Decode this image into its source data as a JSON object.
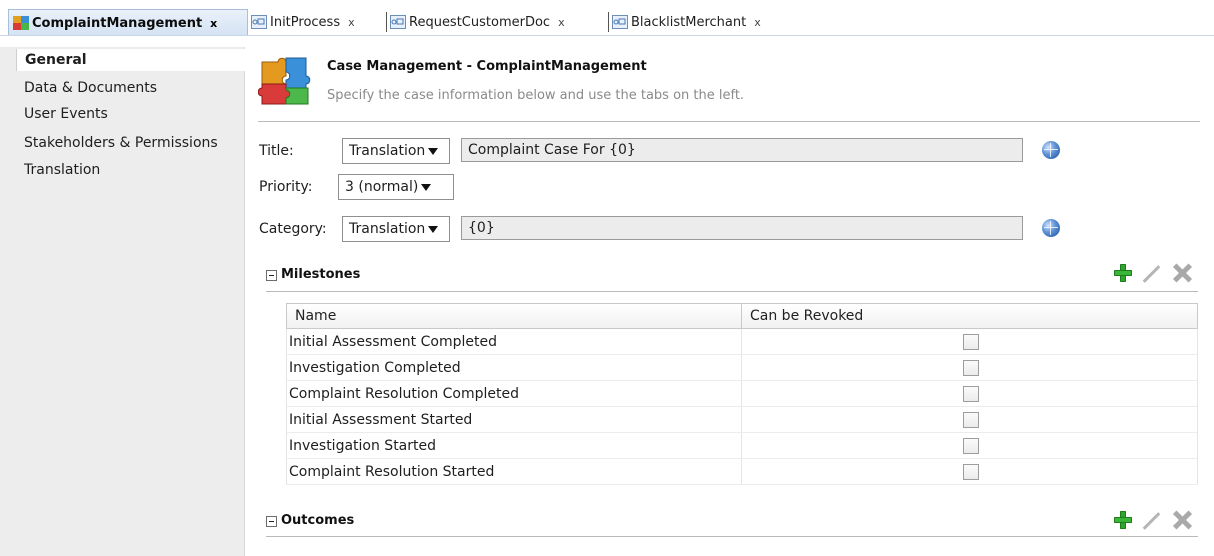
{
  "tabs": [
    {
      "label": "ComplaintManagement",
      "close": "x",
      "active": true
    },
    {
      "label": "InitProcess",
      "close": "x",
      "active": false
    },
    {
      "label": "RequestCustomerDoc",
      "close": "x",
      "active": false
    },
    {
      "label": "BlacklistMerchant",
      "close": "x",
      "active": false
    }
  ],
  "sidebar": {
    "items": [
      {
        "label": "General",
        "selected": true
      },
      {
        "label": "Data & Documents"
      },
      {
        "label": "User Events"
      },
      {
        "label": "Stakeholders & Permissions"
      },
      {
        "label": "Translation"
      }
    ]
  },
  "header": {
    "title": "Case Management - ComplaintManagement",
    "subtitle": "Specify the case information below and use the tabs on the left."
  },
  "form": {
    "title_label": "Title:",
    "title_mode": "Translation",
    "title_value": "Complaint Case For {0}",
    "priority_label": "Priority:",
    "priority_value": "3 (normal)",
    "category_label": "Category:",
    "category_mode": "Translation",
    "category_value": "{0}"
  },
  "milestones": {
    "title": "Milestones",
    "columns": [
      "Name",
      "Can be Revoked"
    ],
    "rows": [
      {
        "name": "Initial Assessment Completed",
        "revoked": false
      },
      {
        "name": "Investigation Completed",
        "revoked": false
      },
      {
        "name": "Complaint Resolution Completed",
        "revoked": false
      },
      {
        "name": "Initial Assessment Started",
        "revoked": false
      },
      {
        "name": "Investigation Started",
        "revoked": false
      },
      {
        "name": "Complaint Resolution Started",
        "revoked": false
      }
    ]
  },
  "outcomes": {
    "title": "Outcomes"
  },
  "colors": {
    "accent_green": "#39b539",
    "tab_active_bg": "#d4e2f3",
    "sidebar_bg": "#ededed"
  }
}
